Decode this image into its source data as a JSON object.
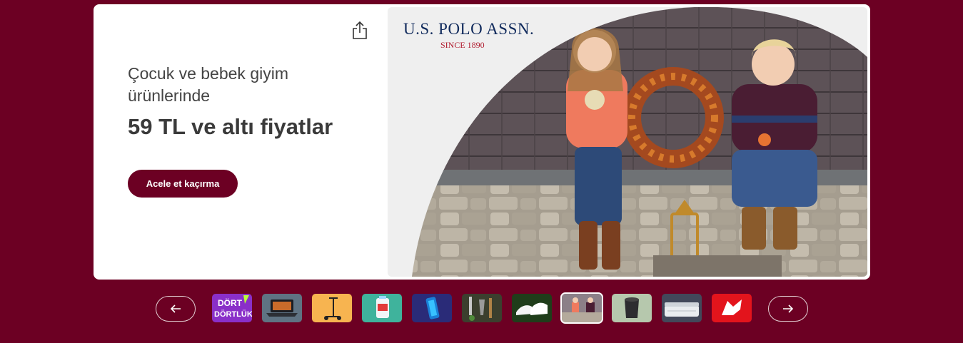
{
  "banner": {
    "subtitle": "Çocuk ve bebek giyim ürünlerinde",
    "headline": "59 TL ve altı fiyatlar",
    "cta_label": "Acele et kaçırma",
    "share_icon": "share-icon"
  },
  "hero": {
    "brand_name": "U.S. POLO ASSN.",
    "brand_since": "SINCE 1890"
  },
  "carousel": {
    "prev_icon": "arrow-left-icon",
    "next_icon": "arrow-right-icon",
    "thumbnails": [
      {
        "name": "thumb-dort-dortluk",
        "text_top": "DÖRT",
        "text_bottom": "DÖRTLÜK",
        "active": false
      },
      {
        "name": "thumb-laptop",
        "active": false
      },
      {
        "name": "thumb-scooter",
        "active": false
      },
      {
        "name": "thumb-detergent",
        "active": false
      },
      {
        "name": "thumb-phone",
        "active": false
      },
      {
        "name": "thumb-garden-tools",
        "active": false
      },
      {
        "name": "thumb-sneakers",
        "active": false
      },
      {
        "name": "thumb-kids-clothing",
        "active": true
      },
      {
        "name": "thumb-speaker",
        "active": false
      },
      {
        "name": "thumb-mattress",
        "active": false
      },
      {
        "name": "thumb-brand-logo",
        "active": false
      }
    ]
  },
  "colors": {
    "background": "#6c0023",
    "cta": "#6c0023",
    "text": "#444444"
  }
}
